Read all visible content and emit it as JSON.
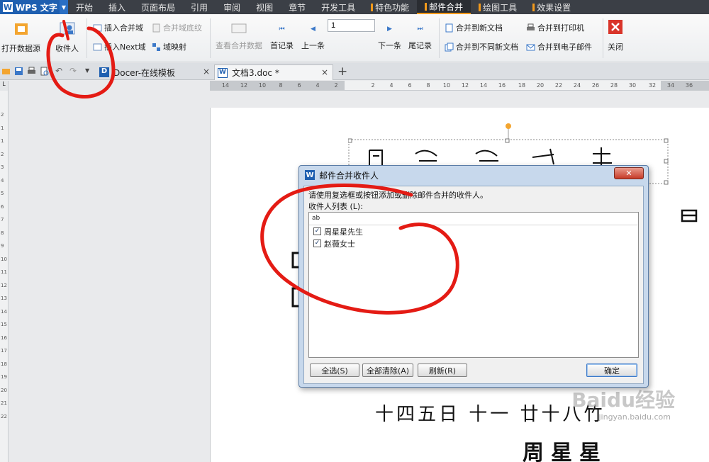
{
  "app": {
    "name": "WPS 文字",
    "logo_letter": "W"
  },
  "menu": [
    "开始",
    "插入",
    "页面布局",
    "引用",
    "审阅",
    "视图",
    "章节",
    "开发工具",
    "特色功能",
    "邮件合并",
    "绘图工具",
    "效果设置"
  ],
  "ribbon": {
    "open_source": "打开数据源",
    "recipients": "收件人",
    "insert_merge_field": "插入合并域",
    "merge_field_shading": "合并域底纹",
    "insert_next": "插入Next域",
    "field_mapping": "域映射",
    "view_merged_data": "查看合并数据",
    "first_record": "首记录",
    "prev_record": "上一条",
    "record_input": "1",
    "next_record": "下一条",
    "last_record": "尾记录",
    "merge_new_doc": "合并到新文档",
    "merge_diff_doc": "合并到不同新文档",
    "merge_printer": "合并到打印机",
    "merge_email": "合并到电子邮件",
    "close": "关闭"
  },
  "tabs": [
    {
      "label": "Docer-在线模板",
      "close": "×"
    },
    {
      "label": "文档3.doc *",
      "close": "×"
    }
  ],
  "tab_add": "+",
  "ruler_corner": "L",
  "hruler": [
    "14",
    "12",
    "10",
    "8",
    "6",
    "4",
    "2",
    "2",
    "4",
    "6",
    "8",
    "10",
    "12",
    "14",
    "16",
    "18",
    "20",
    "22",
    "24",
    "26",
    "28",
    "30",
    "32",
    "34",
    "36"
  ],
  "vruler": [
    "2",
    "1",
    "1",
    "2",
    "3",
    "4",
    "5",
    "6",
    "7",
    "8",
    "9",
    "10",
    "11",
    "12",
    "13",
    "14",
    "15",
    "16",
    "17",
    "18",
    "19",
    "20",
    "21",
    "22"
  ],
  "dialog": {
    "title": "邮件合并收件人",
    "close": "✕",
    "instruction": "请使用复选框或按钮添加或删除邮件合并的收件人。",
    "list_label": "收件人列表 (L):",
    "column_header": "ab",
    "recipients": [
      {
        "name": "周星星先生",
        "checked": true
      },
      {
        "name": "赵薇女士",
        "checked": true
      }
    ],
    "buttons": {
      "select_all": "全选(S)",
      "clear_all": "全部清除(A)",
      "refresh": "刷新(R)",
      "ok": "确定"
    }
  },
  "page_text": {
    "bottom_line": "十四五日  十一  廿十八竹",
    "bottom_line2": "周星星"
  },
  "watermark": {
    "brand": "Baidu经验",
    "url": "jingyan.baidu.com"
  }
}
